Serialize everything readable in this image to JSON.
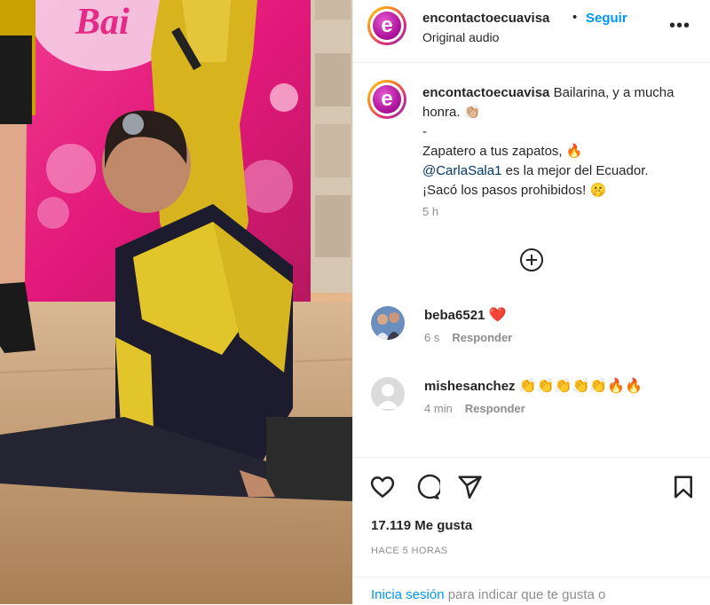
{
  "post": {
    "username": "encontactoecuavisa",
    "bullet": "•",
    "follow_label": "Seguir",
    "audio_label": "Original audio",
    "more_label": "•••"
  },
  "caption": {
    "username": "encontactoecuavisa",
    "line1": "Bailarina, y a mucha honra. 👏🏼",
    "dash": "-",
    "line2": "Zapatero a tus zapatos, 🔥",
    "mention": "@CarlaSala1",
    "line3": " es la mejor del Ecuador.",
    "line4": "¡Sacó los pasos prohibidos! 🤫",
    "time": "5 h"
  },
  "comments": [
    {
      "user": "beba6521",
      "text": "❤️",
      "time": "6 s",
      "reply": "Responder"
    },
    {
      "user": "mishesanchez",
      "text": "👏👏👏👏👏🔥🔥",
      "time": "4 min",
      "reply": "Responder"
    }
  ],
  "stats": {
    "likes": "17.119 Me gusta",
    "date": "HACE 5 HORAS"
  },
  "login": {
    "link": "Inicia sesión",
    "rest": " para indicar que te gusta o"
  },
  "icons": {
    "like": "heart-icon",
    "comment": "comment-icon",
    "share": "paper-plane-icon",
    "save": "bookmark-icon",
    "add_comment": "plus-circle-icon"
  },
  "media": {
    "sign_text": "Bai"
  },
  "colors": {
    "accent": "#0095f6",
    "brand": "#b1169e",
    "text": "#262626",
    "muted": "#8e8e8e"
  }
}
